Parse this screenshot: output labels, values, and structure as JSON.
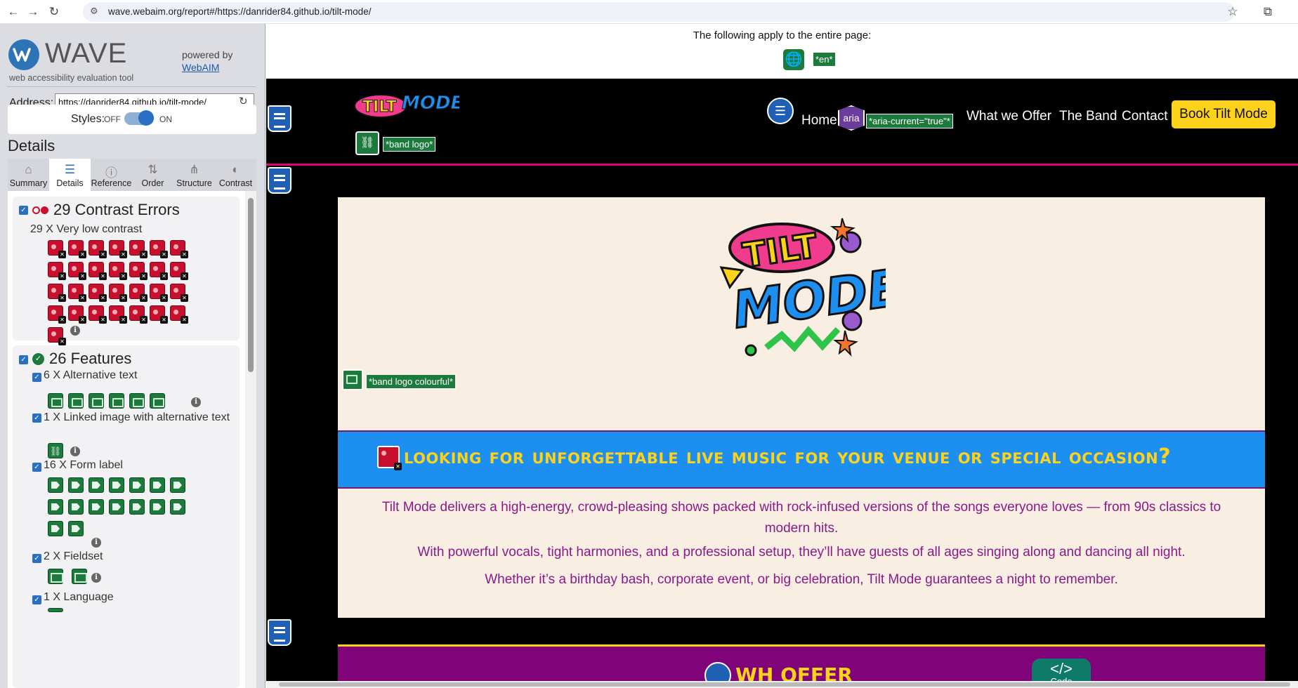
{
  "browser": {
    "url": "wave.webaim.org/report#/https://danrider84.github.io/tilt-mode/",
    "icons": [
      "back-icon",
      "forward-icon",
      "reload-icon",
      "site-info-icon",
      "star-icon",
      "extensions-icon"
    ]
  },
  "sidebar": {
    "logo_word": "WAVE",
    "logo_sub": "web accessibility evaluation tool",
    "powered_by": "powered by",
    "webaim_link": "WebAIM",
    "address_label": "Address:",
    "address_value": "https://danrider84.github.io/tilt-mode/",
    "styles_label": "Styles:",
    "off_label": "OFF",
    "on_label": "ON",
    "details_title": "Details",
    "tabs": [
      {
        "label": "Summary",
        "icon": "home-icon"
      },
      {
        "label": "Details",
        "icon": "list-icon"
      },
      {
        "label": "Reference",
        "icon": "info-icon"
      },
      {
        "label": "Order",
        "icon": "order-icon"
      },
      {
        "label": "Structure",
        "icon": "structure-icon"
      },
      {
        "label": "Contrast",
        "icon": "contrast-icon"
      }
    ],
    "contrast": {
      "title": "29 Contrast Errors",
      "sub": "29 X Very low contrast"
    },
    "features": {
      "title": "26 Features",
      "items": [
        {
          "label": "6 X Alternative text"
        },
        {
          "label": "1 X Linked image with alternative text"
        },
        {
          "label": "16 X Form label"
        },
        {
          "label": "2 X Fieldset"
        },
        {
          "label": "1 X Language"
        }
      ]
    },
    "info_glyph": "i"
  },
  "page": {
    "apply_text": "The following apply to the entire page:",
    "lang_tag": "*en*",
    "band_logo_tag": "*band logo*",
    "aria_badge": "aria",
    "aria_current_tag": "*aria-current=\"true\"*",
    "nav": {
      "home": "Home",
      "offer": "What we Offer",
      "band": "The Band",
      "contact": "Contact",
      "book": "Book Tilt Mode"
    },
    "logo_colourful_tag": "*band logo colourful*",
    "banner": "Looking for unforgettable live music for your venue or special occasion?",
    "paragraphs": [
      "Tilt Mode delivers a high-energy, crowd-pleasing shows packed with rock-infused versions of the songs everyone loves — from 90s classics to modern hits.",
      "With powerful vocals, tight harmonies, and a professional setup, they’ll have guests of all ages singing along and dancing all night.",
      "Whether it’s a birthday bash, corporate event, or big celebration, Tilt Mode guarantees a night to remember."
    ],
    "offer_heading_visible": "WH    OFFER",
    "code_glyph": "</>",
    "code_label": "Code",
    "logo_tilt": "TILT",
    "logo_mode": "MODE"
  },
  "colors": {
    "wave_blue": "#2d74b6",
    "error_red": "#c8102e",
    "feature_green": "#1d7a3d",
    "banner_blue": "#1c8ff0",
    "accent_yellow": "#fdd21a",
    "magenta": "#e4007c",
    "text_purple": "#8a1a8a",
    "cream": "#f8eee1"
  }
}
